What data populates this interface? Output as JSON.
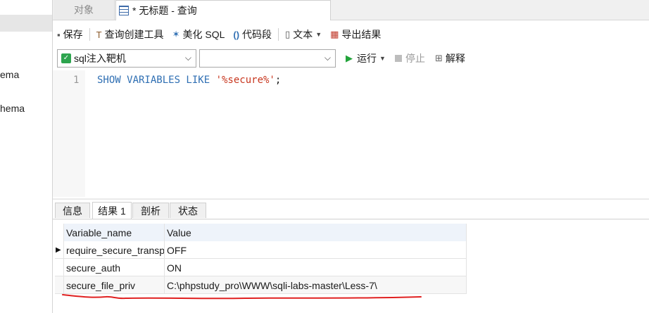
{
  "left_panel": {
    "items": [
      "ema",
      "hema"
    ]
  },
  "tabs": {
    "objects_label": "对象",
    "query_label": "* 无标题 - 查询"
  },
  "toolbar": {
    "save": "保存",
    "query_builder": "查询创建工具",
    "beautify_sql": "美化 SQL",
    "code_snippet": "代码段",
    "text": "文本",
    "export_results": "导出结果"
  },
  "selectors": {
    "connection_value": "sql注入靶机",
    "database_value": "",
    "run": "运行",
    "stop": "停止",
    "explain": "解释"
  },
  "editor": {
    "line_number": "1",
    "code_keyword": "SHOW VARIABLES LIKE ",
    "code_string": "'%secure%'",
    "code_end": ";"
  },
  "result_tabs": [
    "信息",
    "结果 1",
    "剖析",
    "状态"
  ],
  "grid": {
    "columns": [
      "Variable_name",
      "Value"
    ],
    "rows": [
      {
        "name": "require_secure_transport",
        "value": "OFF"
      },
      {
        "name": "secure_auth",
        "value": "ON"
      },
      {
        "name": "secure_file_priv",
        "value": "C:\\phpstudy_pro\\WWW\\sqli-labs-master\\Less-7\\"
      }
    ]
  },
  "colors": {
    "annotation_underline": "#e02020",
    "run_icon": "#22a33a",
    "keyword": "#2f6fb3",
    "string": "#c8371f"
  }
}
